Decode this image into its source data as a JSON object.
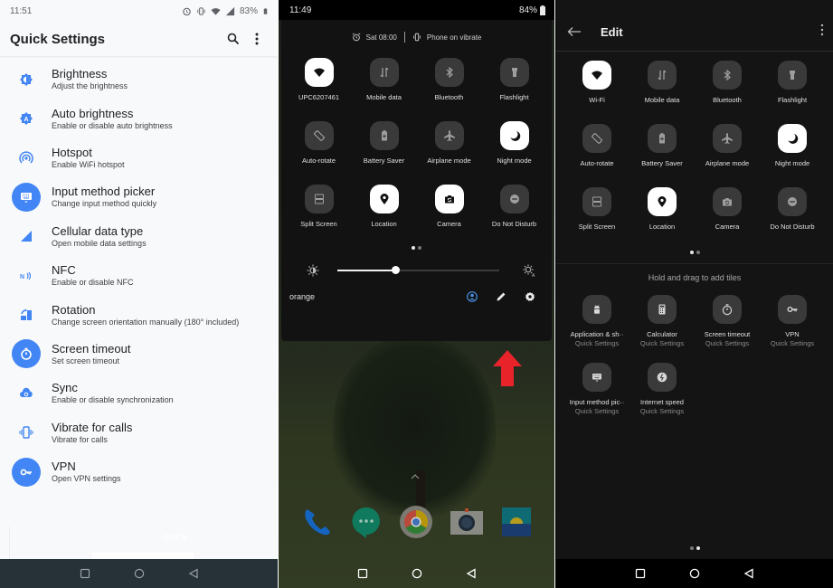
{
  "colors": {
    "accent_blue": "#4285f4",
    "dark_bg": "#121212",
    "tile_off": "#3a3a3a",
    "tile_on": "#ffffff",
    "arrow_red": "#e8232a",
    "light_bg": "#f8f9fa",
    "light_nav": "#263238"
  },
  "panel_left": {
    "status": {
      "time": "11:51",
      "battery": "83%",
      "icons": [
        "alarm-icon",
        "vibrate-icon",
        "wifi-icon",
        "signal-icon",
        "battery-icon"
      ]
    },
    "appbar": {
      "title": "Quick Settings",
      "actions": [
        "search-icon",
        "more-vert-icon"
      ]
    },
    "items": [
      {
        "title": "Brightness",
        "subtitle": "Adjust the brightness",
        "icon": "brightness-icon",
        "active": false
      },
      {
        "title": "Auto brightness",
        "subtitle": "Enable or disable auto brightness",
        "icon": "auto-brightness-icon",
        "active": false
      },
      {
        "title": "Hotspot",
        "subtitle": "Enable WiFi hotspot",
        "icon": "hotspot-icon",
        "active": false
      },
      {
        "title": "Input method picker",
        "subtitle": "Change input method quickly",
        "icon": "keyboard-icon",
        "active": true
      },
      {
        "title": "Cellular data type",
        "subtitle": "Open mobile data settings",
        "icon": "cellular-icon",
        "active": false
      },
      {
        "title": "NFC",
        "subtitle": "Enable or disable NFC",
        "icon": "nfc-icon",
        "active": false
      },
      {
        "title": "Rotation",
        "subtitle": "Change screen orientation manually (180° included)",
        "icon": "rotation-icon",
        "active": false
      },
      {
        "title": "Screen timeout",
        "subtitle": "Set screen timeout",
        "icon": "timer-icon",
        "active": true
      },
      {
        "title": "Sync",
        "subtitle": "Enable or disable synchronization",
        "icon": "sync-icon",
        "active": false
      },
      {
        "title": "Vibrate for calls",
        "subtitle": "Vibrate for calls",
        "icon": "vibrate-icon",
        "active": false
      },
      {
        "title": "VPN",
        "subtitle": "Open VPN settings",
        "icon": "vpn-key-icon",
        "active": true
      }
    ],
    "ghost_button": "OPEN"
  },
  "panel_middle": {
    "status": {
      "time": "11:49",
      "battery": "84%"
    },
    "info": {
      "alarm": "Sat 08:00",
      "ringer": "Phone on vibrate"
    },
    "tiles": [
      {
        "label": "UPC6207461",
        "icon": "wifi-icon",
        "on": true
      },
      {
        "label": "Mobile data",
        "icon": "mobile-data-icon",
        "on": false
      },
      {
        "label": "Bluetooth",
        "icon": "bluetooth-icon",
        "on": false
      },
      {
        "label": "Flashlight",
        "icon": "flashlight-icon",
        "on": false
      },
      {
        "label": "Auto-rotate",
        "icon": "auto-rotate-icon",
        "on": false
      },
      {
        "label": "Battery Saver",
        "icon": "battery-saver-icon",
        "on": false
      },
      {
        "label": "Airplane mode",
        "icon": "airplane-icon",
        "on": false
      },
      {
        "label": "Night mode",
        "icon": "night-mode-icon",
        "on": true
      },
      {
        "label": "Split Screen",
        "icon": "split-screen-icon",
        "on": false
      },
      {
        "label": "Location",
        "icon": "location-icon",
        "on": true
      },
      {
        "label": "Camera",
        "icon": "camera-icon",
        "on": true
      },
      {
        "label": "Do Not Disturb",
        "icon": "dnd-icon",
        "on": false
      }
    ],
    "page_dots": {
      "count": 2,
      "active": 0
    },
    "brightness": {
      "level": 0.36
    },
    "carrier": "orange",
    "footer_actions": [
      "user-icon",
      "edit-pencil-icon",
      "settings-gear-icon"
    ],
    "dock_apps": [
      "phone-app",
      "hangouts-app",
      "chrome-app",
      "camera-app",
      "gallery-app"
    ]
  },
  "panel_right": {
    "appbar": {
      "title": "Edit"
    },
    "tiles": [
      {
        "label": "Wi-Fi",
        "icon": "wifi-icon",
        "on": true
      },
      {
        "label": "Mobile data",
        "icon": "mobile-data-icon",
        "on": false
      },
      {
        "label": "Bluetooth",
        "icon": "bluetooth-icon",
        "on": false
      },
      {
        "label": "Flashlight",
        "icon": "flashlight-icon",
        "on": false
      },
      {
        "label": "Auto-rotate",
        "icon": "auto-rotate-icon",
        "on": false
      },
      {
        "label": "Battery Saver",
        "icon": "battery-saver-icon",
        "on": false
      },
      {
        "label": "Airplane mode",
        "icon": "airplane-icon",
        "on": false
      },
      {
        "label": "Night mode",
        "icon": "night-mode-icon",
        "on": true
      },
      {
        "label": "Split Screen",
        "icon": "split-screen-icon",
        "on": false
      },
      {
        "label": "Location",
        "icon": "location-icon",
        "on": true
      },
      {
        "label": "Camera",
        "icon": "camera-icon",
        "on": false
      },
      {
        "label": "Do Not Disturb",
        "icon": "dnd-icon",
        "on": false
      }
    ],
    "page_dots_top": {
      "count": 2,
      "active": 0
    },
    "hold_text": "Hold and drag to add tiles",
    "available_tiles": [
      {
        "label": "Application & sh··",
        "sub": "Quick Settings",
        "icon": "android-icon"
      },
      {
        "label": "Calculator",
        "sub": "Quick Settings",
        "icon": "calculator-icon"
      },
      {
        "label": "Screen timeout",
        "sub": "Quick Settings",
        "icon": "timer-icon"
      },
      {
        "label": "VPN",
        "sub": "Quick Settings",
        "icon": "vpn-key-icon"
      },
      {
        "label": "Input method pic··",
        "sub": "Quick Settings",
        "icon": "keyboard-icon"
      },
      {
        "label": "Internet speed",
        "sub": "Quick Settings",
        "icon": "speed-icon"
      }
    ],
    "page_dots_bottom": {
      "count": 2,
      "active": 1
    }
  }
}
